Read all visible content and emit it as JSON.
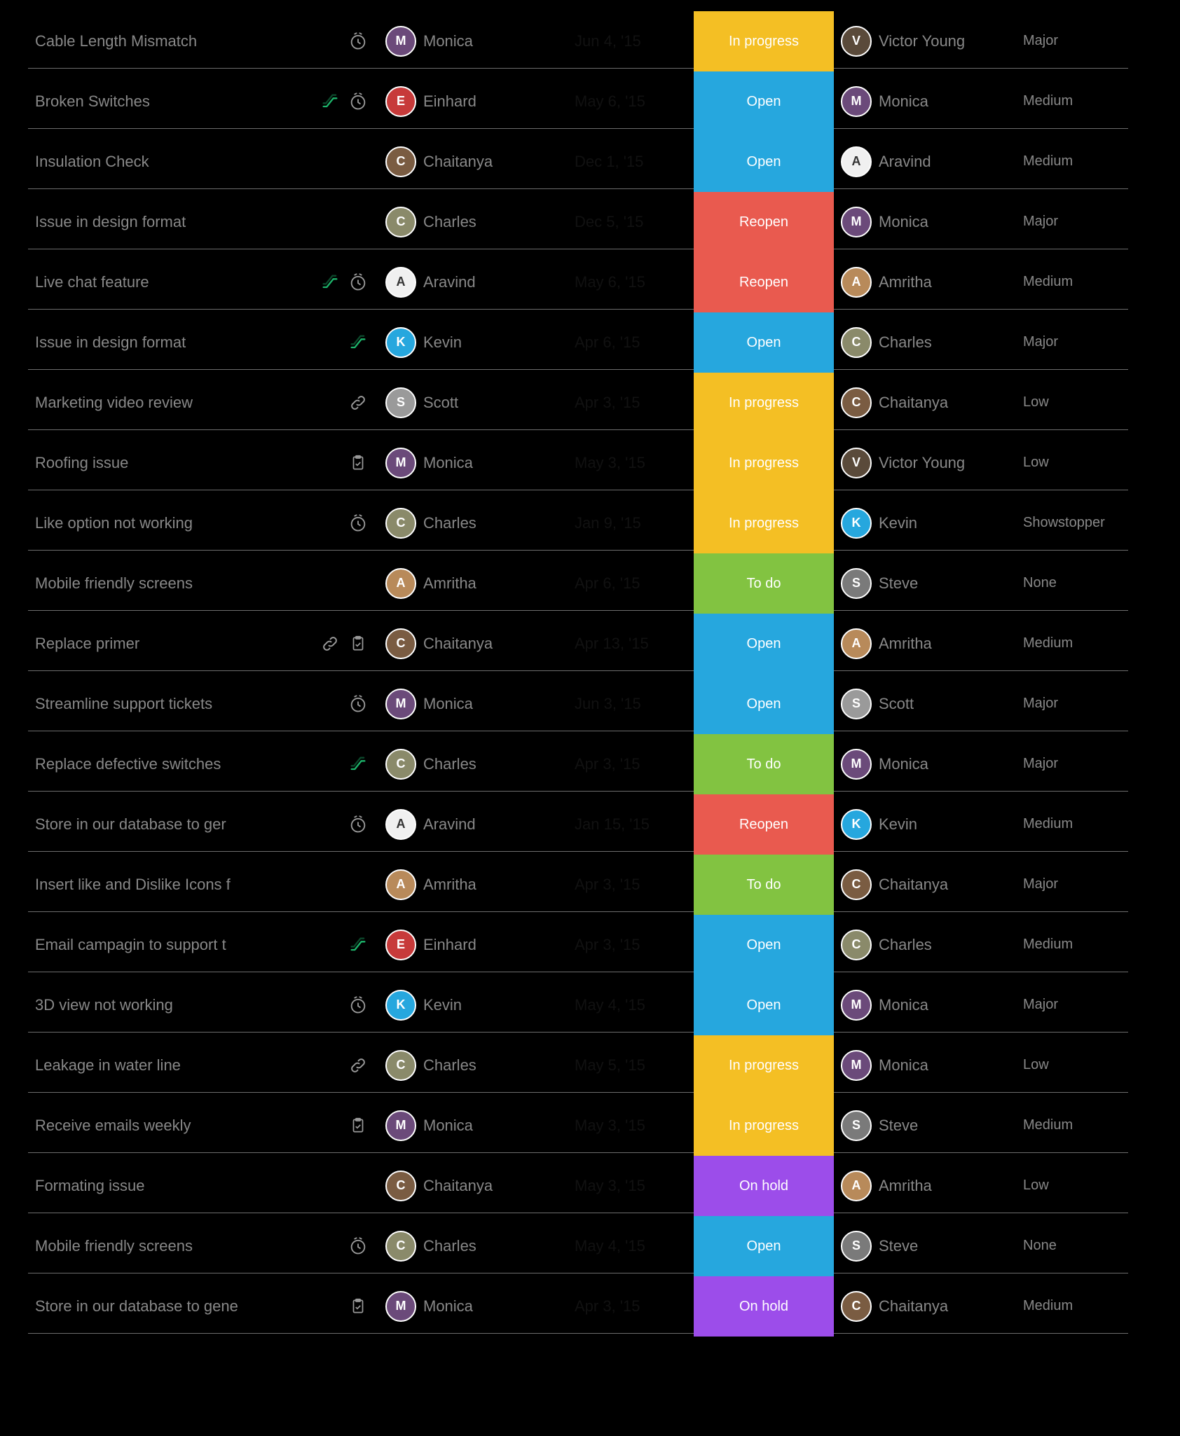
{
  "statuses": {
    "inprogress": "In progress",
    "open": "Open",
    "reopen": "Reopen",
    "todo": "To do",
    "onhold": "On hold"
  },
  "people": {
    "monica": {
      "name": "Monica",
      "initial": "M",
      "avatarClass": "av-monica"
    },
    "einhard": {
      "name": "Einhard",
      "initial": "E",
      "avatarClass": "av-einhard"
    },
    "chaitanya": {
      "name": "Chaitanya",
      "initial": "C",
      "avatarClass": "av-chaitanya"
    },
    "charles": {
      "name": "Charles",
      "initial": "C",
      "avatarClass": "av-charles"
    },
    "aravind": {
      "name": "Aravind",
      "initial": "A",
      "avatarClass": "av-aravind"
    },
    "kevin": {
      "name": "Kevin",
      "initial": "K",
      "avatarClass": "av-kevin"
    },
    "scott": {
      "name": "Scott",
      "initial": "S",
      "avatarClass": "av-scott"
    },
    "amritha": {
      "name": "Amritha",
      "initial": "A",
      "avatarClass": "av-amritha"
    },
    "victor": {
      "name": "Victor Young",
      "initial": "V",
      "avatarClass": "av-victor"
    },
    "steve": {
      "name": "Steve",
      "initial": "S",
      "avatarClass": "av-steve"
    }
  },
  "tasks": [
    {
      "title": "Cable Length Mismatch",
      "icons": [
        "clock"
      ],
      "assignee": "monica",
      "date": "Jun 4, '15",
      "status": "inprogress",
      "reporter": "victor",
      "priority": "Major"
    },
    {
      "title": "Broken Switches",
      "icons": [
        "escalator",
        "clock"
      ],
      "assignee": "einhard",
      "date": "May 6, '15",
      "status": "open",
      "reporter": "monica",
      "priority": "Medium"
    },
    {
      "title": "Insulation Check",
      "icons": [],
      "assignee": "chaitanya",
      "date": "Dec 1, '15",
      "status": "open",
      "reporter": "aravind",
      "priority": "Medium"
    },
    {
      "title": "Issue in design format",
      "icons": [],
      "assignee": "charles",
      "date": "Dec 5, '15",
      "status": "reopen",
      "reporter": "monica",
      "priority": "Major"
    },
    {
      "title": "Live chat feature",
      "icons": [
        "escalator",
        "clock"
      ],
      "assignee": "aravind",
      "date": "May 6, '15",
      "status": "reopen",
      "reporter": "amritha",
      "priority": "Medium"
    },
    {
      "title": "Issue in design format",
      "icons": [
        "escalator"
      ],
      "assignee": "kevin",
      "date": "Apr 6, '15",
      "status": "open",
      "reporter": "charles",
      "priority": "Major"
    },
    {
      "title": "Marketing video review",
      "icons": [
        "link"
      ],
      "assignee": "scott",
      "date": "Apr 3, '15",
      "status": "inprogress",
      "reporter": "chaitanya",
      "priority": "Low"
    },
    {
      "title": "Roofing issue",
      "icons": [
        "clipboard"
      ],
      "assignee": "monica",
      "date": "May 3, '15",
      "status": "inprogress",
      "reporter": "victor",
      "priority": "Low"
    },
    {
      "title": "Like option not working",
      "icons": [
        "clock"
      ],
      "assignee": "charles",
      "date": "Jan 9, '15",
      "status": "inprogress",
      "reporter": "kevin",
      "priority": "Showstopper"
    },
    {
      "title": "Mobile friendly screens",
      "icons": [],
      "assignee": "amritha",
      "date": "Apr 6, '15",
      "status": "todo",
      "reporter": "steve",
      "priority": "None"
    },
    {
      "title": "Replace primer",
      "icons": [
        "link",
        "clipboard"
      ],
      "assignee": "chaitanya",
      "date": "Apr 13, '15",
      "status": "open",
      "reporter": "amritha",
      "priority": "Medium"
    },
    {
      "title": "Streamline support tickets",
      "icons": [
        "clock"
      ],
      "assignee": "monica",
      "date": "Jun 3, '15",
      "status": "open",
      "reporter": "scott",
      "priority": "Major"
    },
    {
      "title": "Replace defective switches",
      "icons": [
        "escalator"
      ],
      "assignee": "charles",
      "date": "Apr 3, '15",
      "status": "todo",
      "reporter": "monica",
      "priority": "Major"
    },
    {
      "title": "Store in our database to ger",
      "icons": [
        "clock"
      ],
      "assignee": "aravind",
      "date": "Jan 15, '15",
      "status": "reopen",
      "reporter": "kevin",
      "priority": "Medium"
    },
    {
      "title": "Insert like and Dislike Icons f",
      "icons": [],
      "assignee": "amritha",
      "date": "Apr 3, '15",
      "status": "todo",
      "reporter": "chaitanya",
      "priority": "Major"
    },
    {
      "title": "Email campagin to support t",
      "icons": [
        "escalator"
      ],
      "assignee": "einhard",
      "date": "Apr 3, '15",
      "status": "open",
      "reporter": "charles",
      "priority": "Medium"
    },
    {
      "title": "3D view not working",
      "icons": [
        "clock"
      ],
      "assignee": "kevin",
      "date": "May 4, '15",
      "status": "open",
      "reporter": "monica",
      "priority": "Major"
    },
    {
      "title": "Leakage in water line",
      "icons": [
        "link"
      ],
      "assignee": "charles",
      "date": "May 5, '15",
      "status": "inprogress",
      "reporter": "monica",
      "priority": "Low"
    },
    {
      "title": "Receive emails weekly",
      "icons": [
        "clipboard"
      ],
      "assignee": "monica",
      "date": "May 3, '15",
      "status": "inprogress",
      "reporter": "steve",
      "priority": "Medium"
    },
    {
      "title": "Formating issue",
      "icons": [],
      "assignee": "chaitanya",
      "date": "May 3, '15",
      "status": "onhold",
      "reporter": "amritha",
      "priority": "Low"
    },
    {
      "title": "Mobile friendly screens",
      "icons": [
        "clock"
      ],
      "assignee": "charles",
      "date": "May 4, '15",
      "status": "open",
      "reporter": "steve",
      "priority": "None"
    },
    {
      "title": "Store in our database to gene",
      "icons": [
        "clipboard"
      ],
      "assignee": "monica",
      "date": "Apr 3, '15",
      "status": "onhold",
      "reporter": "chaitanya",
      "priority": "Medium"
    }
  ]
}
